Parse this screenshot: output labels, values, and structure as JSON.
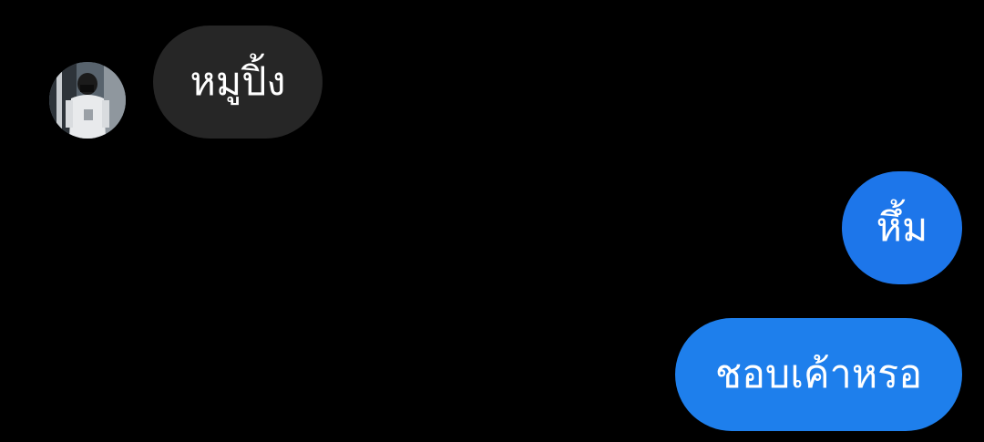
{
  "conversation": {
    "contact": {
      "avatar_icon": "profile-photo-avatar"
    },
    "messages": [
      {
        "sender": "contact",
        "text": "หมูปิ้ง"
      },
      {
        "sender": "me",
        "text": "หึ้ม"
      },
      {
        "sender": "me",
        "text": "ชอบเค้าหรอ"
      }
    ]
  },
  "colors": {
    "background": "#000000",
    "incoming_bubble": "#262626",
    "outgoing_bubble": "#1d76ea",
    "text": "#ffffff"
  }
}
